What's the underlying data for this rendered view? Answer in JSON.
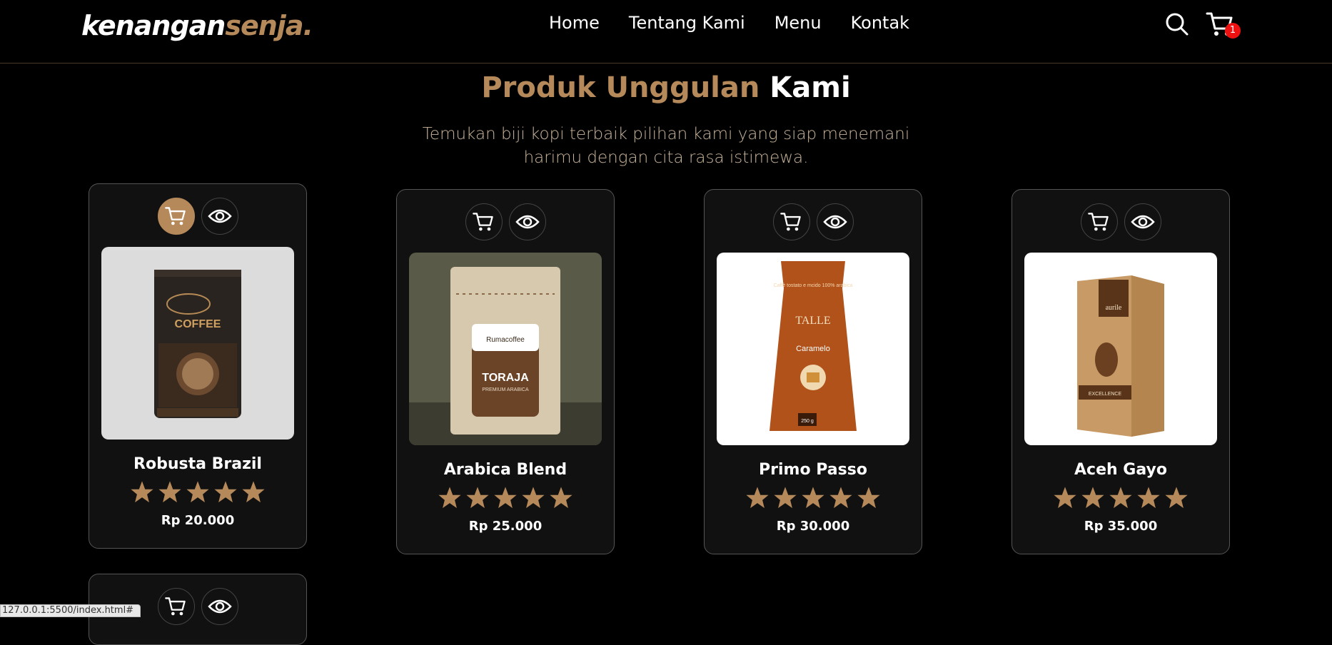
{
  "brand": {
    "part1": "kenangan",
    "part2": "senja."
  },
  "nav": {
    "home": "Home",
    "about": "Tentang Kami",
    "menu": "Menu",
    "contact": "Kontak"
  },
  "cart": {
    "count": "1"
  },
  "section": {
    "title_accent": "Produk Unggulan",
    "title_rest": "Kami",
    "subtitle": "Temukan biji kopi terbaik pilihan kami yang siap menemani harimu dengan cita rasa istimewa."
  },
  "products": [
    {
      "name": "Robusta Brazil",
      "price": "Rp 20.000",
      "rating": 5
    },
    {
      "name": "Arabica Blend",
      "price": "Rp 25.000",
      "rating": 5
    },
    {
      "name": "Primo Passo",
      "price": "Rp 30.000",
      "rating": 5
    },
    {
      "name": "Aceh Gayo",
      "price": "Rp 35.000",
      "rating": 5
    }
  ],
  "package_text": {
    "p1": "COFFEE",
    "p2_brand": "Rumacoffee",
    "p2_title": "TORAJA",
    "p2_sub": "PREMIUM ARABICA",
    "p3_top": "Caffè tostato e mcido 100% arabica",
    "p3_brand": "TALLE",
    "p3_flavor": "Caramelo",
    "p3_weight": "250 g",
    "p4_brand": "aurile",
    "p4_label": "EXCELLENCE"
  },
  "statusbar": {
    "url": "127.0.0.1:5500/index.html#"
  },
  "colors": {
    "accent": "#b6895b",
    "badge": "#e11111"
  }
}
